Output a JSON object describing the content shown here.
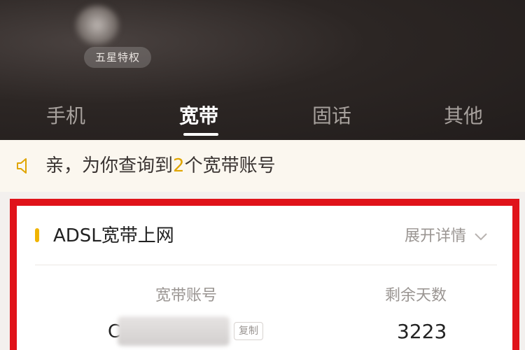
{
  "header": {
    "badge_label": "五星特权"
  },
  "tabs": [
    {
      "label": "手机",
      "active": false
    },
    {
      "label": "宽带",
      "active": true
    },
    {
      "label": "固话",
      "active": false
    },
    {
      "label": "其他",
      "active": false
    }
  ],
  "notice": {
    "icon": "speaker-icon",
    "prefix": "亲，为你查询到",
    "count": "2",
    "suffix": "个宽带账号",
    "highlight_color": "#e0a500"
  },
  "card": {
    "title": "ADSL宽带上网",
    "expand_label": "展开详情",
    "columns": {
      "account_header": "宽带账号",
      "days_header": "剩余天数"
    },
    "account_value_visible": "C",
    "copy_label": "复制",
    "days_value": "3223",
    "border_color": "#e0131a",
    "bullet_color": "#f0b400"
  }
}
